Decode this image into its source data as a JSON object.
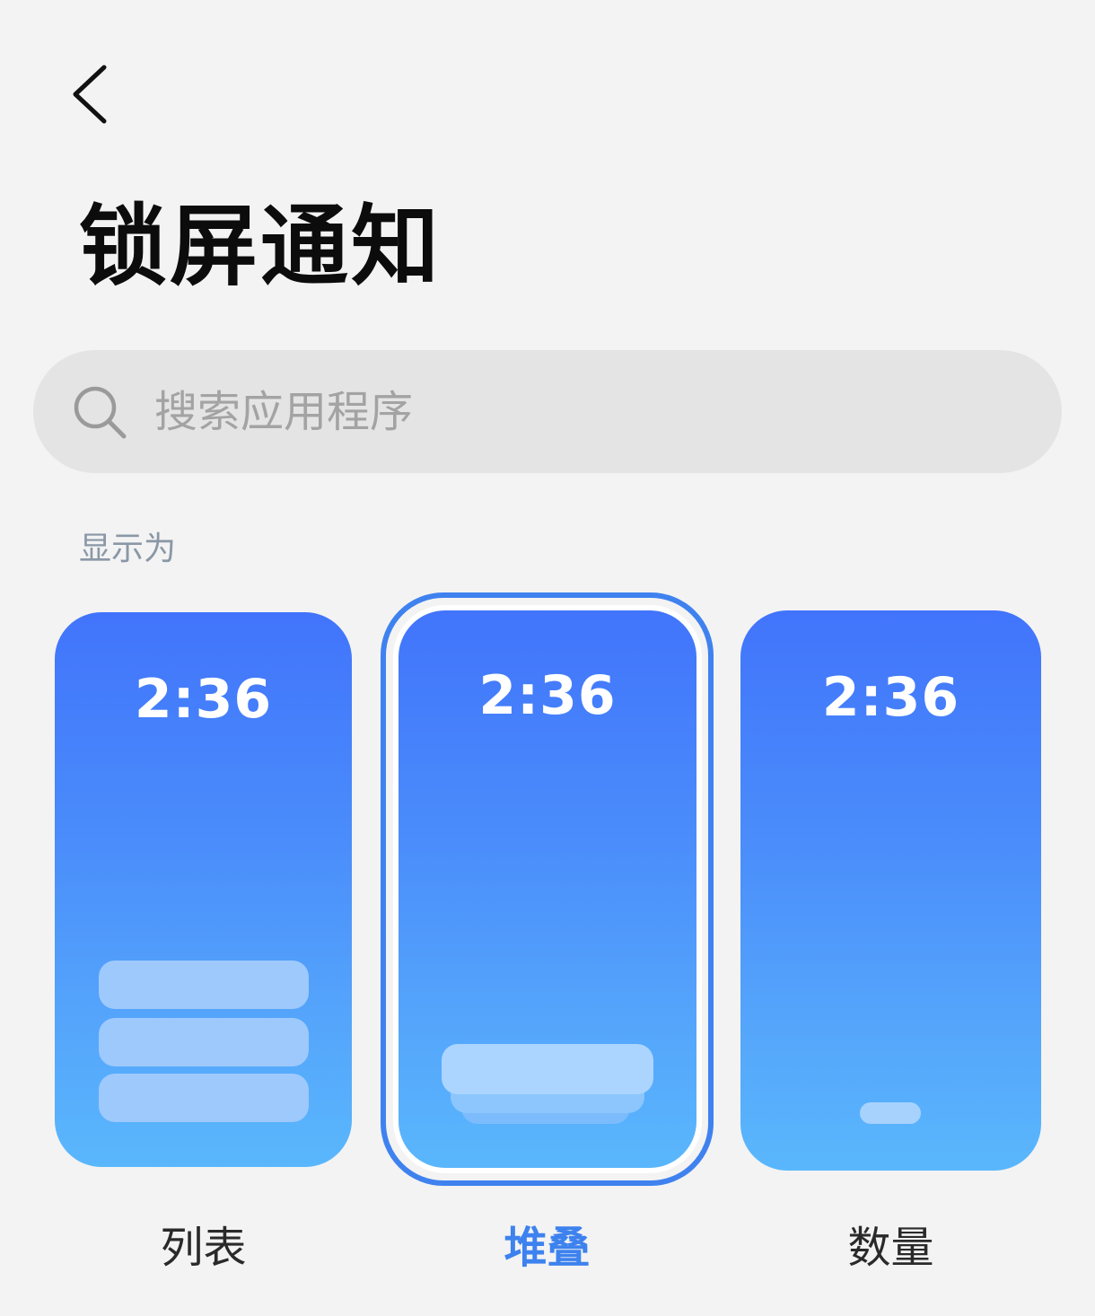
{
  "header": {
    "title": "锁屏通知"
  },
  "search": {
    "placeholder": "搜索应用程序"
  },
  "display_section": {
    "label": "显示为",
    "selected": "堆叠",
    "options": [
      {
        "label": "列表",
        "time": "2:36"
      },
      {
        "label": "堆叠",
        "time": "2:36"
      },
      {
        "label": "数量",
        "time": "2:36"
      }
    ]
  },
  "colors": {
    "accent": "#3f82ef",
    "preview_top": "#4174fb",
    "preview_bottom": "#5ab7fc"
  }
}
